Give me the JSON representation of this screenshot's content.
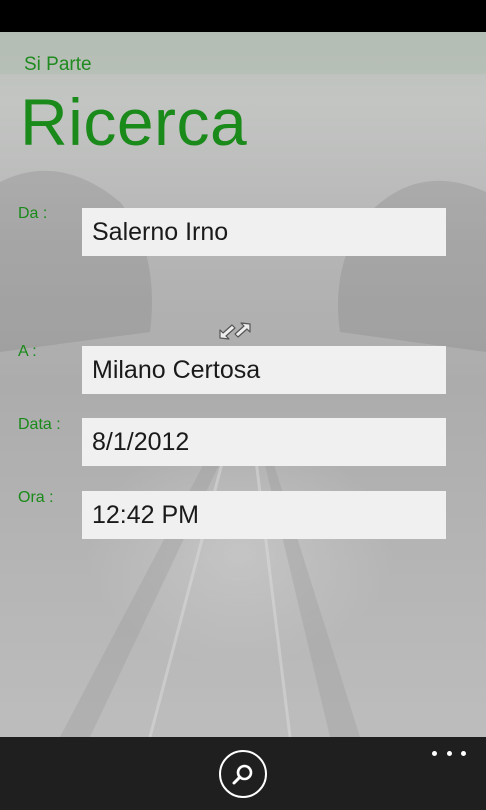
{
  "app": {
    "title": "Si Parte"
  },
  "page": {
    "title": "Ricerca"
  },
  "form": {
    "from": {
      "label": "Da :",
      "value": "Salerno Irno"
    },
    "to": {
      "label": "A :",
      "value": "Milano Certosa"
    },
    "date": {
      "label": "Data :",
      "value": "8/1/2012"
    },
    "time": {
      "label": "Ora :",
      "value": "12:42 PM"
    }
  },
  "icons": {
    "swap": "swap-arrows-icon",
    "search": "search-icon",
    "more": "more-options-icon"
  },
  "colors": {
    "accent": "#1a8a1a",
    "input_background": "#f1f0f1",
    "app_bar": "#1f1f1f"
  }
}
